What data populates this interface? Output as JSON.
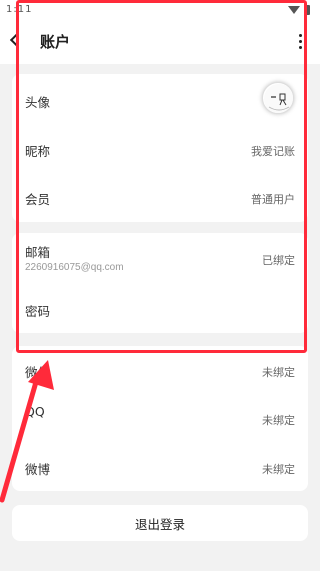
{
  "status_bar": {
    "time": "1:11"
  },
  "header": {
    "title": "账户"
  },
  "profile_section": {
    "avatar_label": "头像",
    "nickname_label": "昵称",
    "nickname_value": "我爱记账",
    "member_label": "会员",
    "member_value": "普通用户"
  },
  "security_section": {
    "email_label": "邮箱",
    "email_address": "2260916075@qq.com",
    "email_status": "已绑定",
    "password_label": "密码"
  },
  "social_section": {
    "wechat_label": "微信",
    "wechat_status": "未绑定",
    "qq_label": "QQ",
    "qq_status": "未绑定",
    "weibo_label": "微博",
    "weibo_status": "未绑定"
  },
  "logout": {
    "label": "退出登录"
  },
  "annotation": {
    "highlight_color": "#ff2a3a"
  }
}
